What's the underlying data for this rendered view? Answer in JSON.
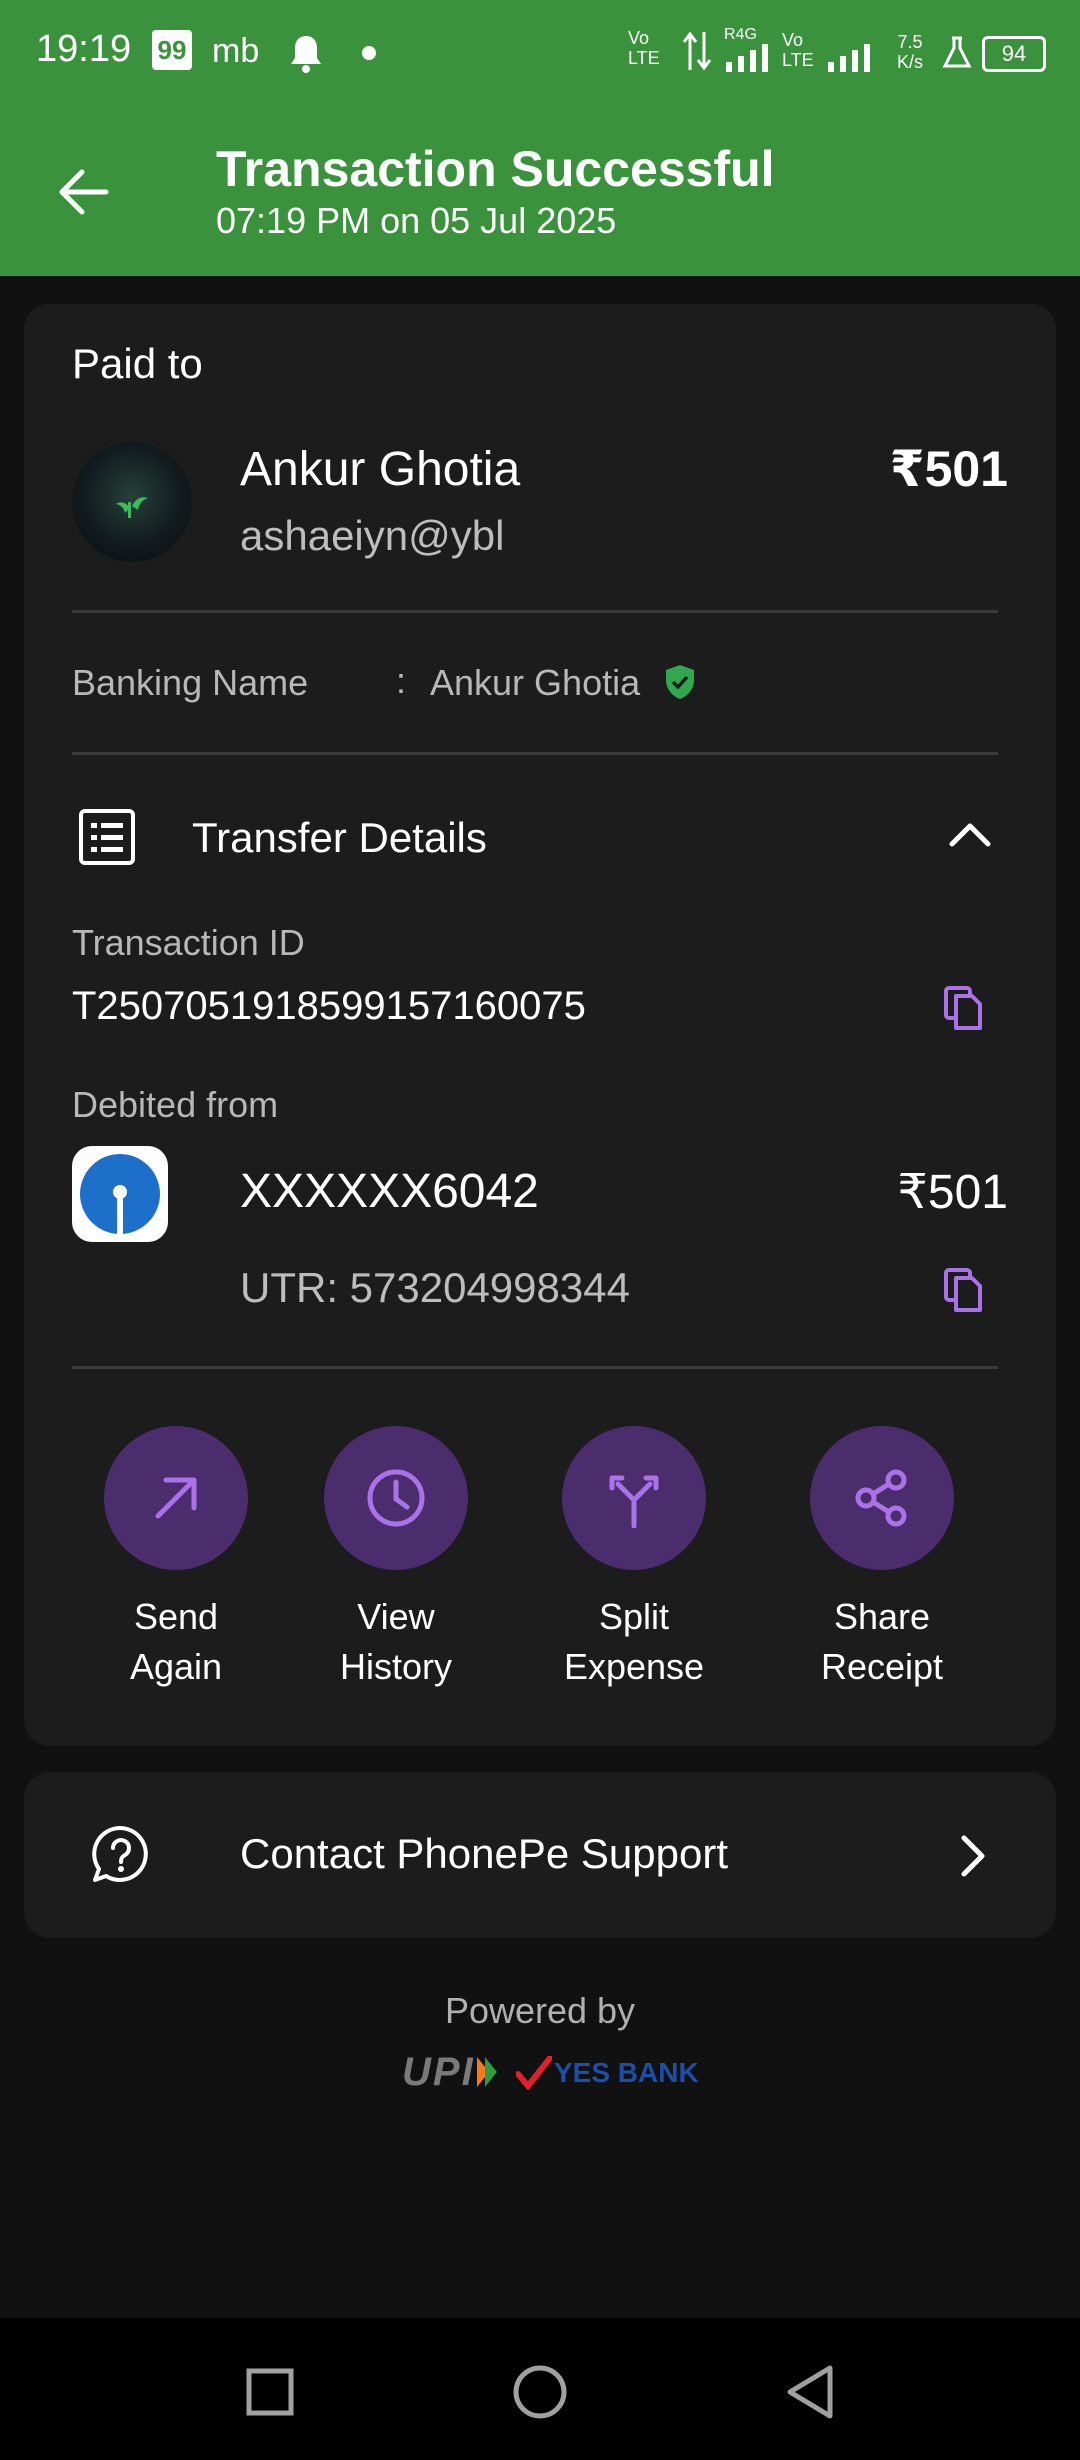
{
  "status_bar": {
    "time": "19:19",
    "badge": "99",
    "carrier": "mb",
    "network_labels": [
      "Vo LTE",
      "R4G",
      "Vo LTE"
    ],
    "speed": "7.5 K/s",
    "battery": "94"
  },
  "header": {
    "title": "Transaction Successful",
    "subtitle": "07:19 PM on 05 Jul 2025",
    "back_icon": "arrow-left-icon",
    "background_color": "#3a923c"
  },
  "payee": {
    "section_label": "Paid to",
    "name": "Ankur Ghotia",
    "upi_id": "ashaeiyn@ybl",
    "amount": "₹501",
    "banking_name_label": "Banking Name",
    "separator": ":",
    "banking_name": "Ankur Ghotia"
  },
  "transfer": {
    "title": "Transfer Details",
    "transaction_id_label": "Transaction ID",
    "transaction_id": "T2507051918599157160075",
    "debited_from_label": "Debited from",
    "account": "XXXXXX6042",
    "amount": "₹501",
    "utr": "UTR: 573204998344"
  },
  "actions": [
    {
      "line1": "Send",
      "line2": "Again",
      "icon": "arrow-up-right-icon"
    },
    {
      "line1": "View",
      "line2": "History",
      "icon": "clock-icon"
    },
    {
      "line1": "Split",
      "line2": "Expense",
      "icon": "split-icon"
    },
    {
      "line1": "Share",
      "line2": "Receipt",
      "icon": "share-icon"
    }
  ],
  "support": {
    "label": "Contact PhonePe Support"
  },
  "footer": {
    "powered_by": "Powered by",
    "upi_logo": "UPI",
    "bank_logo": "YES BANK"
  },
  "colors": {
    "accent_purple": "#a972e6",
    "circle_purple": "#4b2d6e",
    "verified_green": "#2fa84f"
  }
}
